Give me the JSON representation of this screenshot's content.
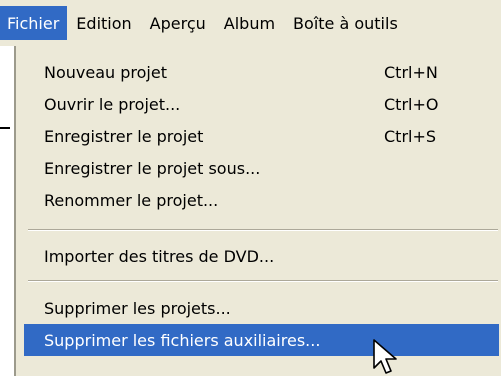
{
  "menubar": {
    "items": [
      {
        "label": "Fichier",
        "active": true
      },
      {
        "label": "Edition"
      },
      {
        "label": "Aperçu"
      },
      {
        "label": "Album"
      },
      {
        "label": "Boîte à outils"
      }
    ]
  },
  "menu": {
    "items": [
      {
        "label": "Nouveau projet",
        "shortcut": "Ctrl+N"
      },
      {
        "label": "Ouvrir le projet...",
        "shortcut": "Ctrl+O"
      },
      {
        "label": "Enregistrer le projet",
        "shortcut": "Ctrl+S"
      },
      {
        "label": "Enregistrer le projet sous...",
        "shortcut": ""
      },
      {
        "label": "Renommer le projet...",
        "shortcut": ""
      },
      {
        "label": "Importer des titres de DVD...",
        "shortcut": ""
      },
      {
        "label": "Supprimer les projets...",
        "shortcut": ""
      },
      {
        "label": "Supprimer les fichiers auxiliaires...",
        "shortcut": "",
        "highlighted": true
      }
    ]
  },
  "colors": {
    "menu_background": "#ece9d8",
    "highlight": "#316ac5",
    "highlight_text": "#ffffff"
  },
  "icons": {
    "cursor": "arrow-pointer-icon"
  }
}
